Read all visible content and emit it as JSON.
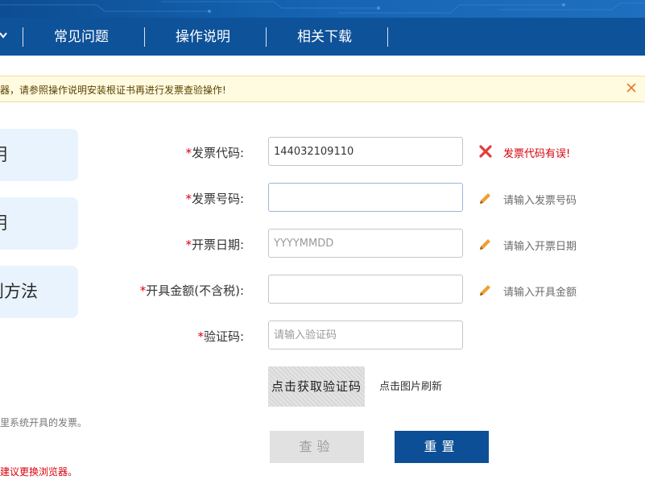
{
  "nav": {
    "items": [
      "常见问题",
      "操作说明",
      "相关下载"
    ]
  },
  "notice": {
    "text": "器，请参照操作说明安装根证书再进行发票查验操作!"
  },
  "side": {
    "cards": [
      "明",
      "明",
      "则方法"
    ],
    "note1": "里系统开具的发票。",
    "note2": "建议更换浏览器。"
  },
  "form": {
    "fpdm": {
      "label": "发票代码:",
      "value": "144032109110",
      "hint": "发票代码有误!"
    },
    "fphm": {
      "label": "发票号码:",
      "value": "",
      "hint": "请输入发票号码"
    },
    "kprq": {
      "label": "开票日期:",
      "placeholder": "YYYYMMDD",
      "hint": "请输入开票日期"
    },
    "kjje": {
      "label": "开具金额(不含税):",
      "value": "",
      "hint": "请输入开具金额"
    },
    "yzm": {
      "label": "验证码:",
      "placeholder": "请输入验证码"
    },
    "required_mark": "*"
  },
  "captcha": {
    "image_text": "点击获取验证码",
    "hint": "点击图片刷新"
  },
  "buttons": {
    "check": "查验",
    "reset": "重置"
  },
  "colors": {
    "nav_bg": "#0e5299",
    "required": "#d8000c",
    "reset_button": "#0d4f96",
    "notice_bg": "#fffbe0"
  }
}
